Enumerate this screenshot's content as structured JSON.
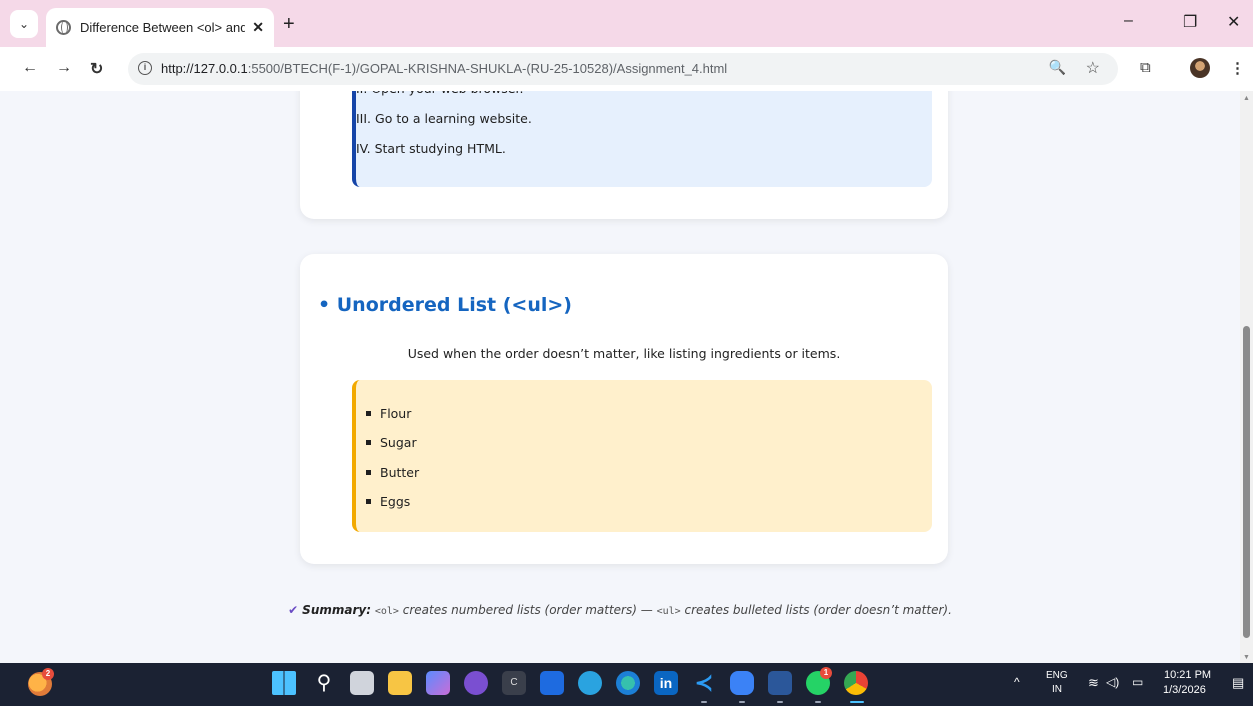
{
  "browser": {
    "tab_title": "Difference Between <ol> and <",
    "tab_close": "✕",
    "new_tab": "+",
    "url_host": "http://127.0.0.1",
    "url_rest": ":5500/BTECH(F-1)/GOPAL-KRISHNA-SHUKLA-(RU-25-10528)/Assignment_4.html",
    "window_controls": {
      "minimize": "–",
      "restore": "❐",
      "close": "✕"
    }
  },
  "ordered_list": {
    "items": [
      "II. Open your web browser.",
      "III. Go to a learning website.",
      "IV. Start studying HTML."
    ],
    "accent": "#1645a8",
    "background": "#e6f0fd"
  },
  "unordered_section": {
    "heading": "• Unordered List (<ul>)",
    "description": "Used when the order doesn’t matter, like listing ingredients or items.",
    "items": [
      "Flour",
      "Sugar",
      "Butter",
      "Eggs"
    ],
    "accent": "#f2a900",
    "background": "#fff0cc",
    "heading_color": "#1565c0"
  },
  "summary": {
    "check": "✔",
    "label": "Summary:",
    "ol_tag": "<ol>",
    "ol_text": " creates numbered lists (order matters) — ",
    "ul_tag": "<ul>",
    "ul_text": " creates bulleted lists (order doesn’t matter)."
  },
  "taskbar": {
    "weather_badge": "2",
    "language": "ENG",
    "region": "IN",
    "time": "10:21 PM",
    "date": "1/3/2026",
    "whatsapp_badge": "1"
  }
}
